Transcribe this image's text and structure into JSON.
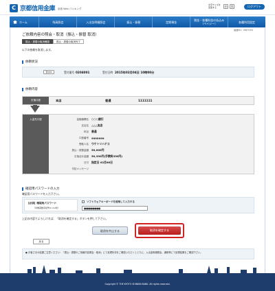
{
  "header": {
    "logo_mark": "C",
    "logo_text": "京都信用金庫",
    "logo_sub": "京信 Web バンキング",
    "font_size_label_1": "文字サイズを",
    "font_size_label_2": "変更する",
    "font_small": "小",
    "font_large": "大",
    "logout": "ログアウト"
  },
  "nav": {
    "items": [
      "ホーム",
      "残高照会",
      "入出金明細照会",
      "振込・振替",
      "定期預金",
      "税金・各種料金の払込み（ペイジー）",
      "各種利用設定"
    ]
  },
  "screen_id": "画面ID：BNT050",
  "main": {
    "title": "ご依頼内容の照会・取消（振込・振替 取消）",
    "steps": [
      "振込・振替の取消確認",
      "振込・振替の取消完了"
    ],
    "instruction": "以下の依頼を取消します。"
  },
  "request_status": {
    "heading": "依頼状況",
    "badge": "受付中",
    "receipt_no_label": "受付番号",
    "receipt_no": "0204001",
    "receipt_dt_label": "受付日時",
    "receipt_dt": "2015年02月04日 10時00分"
  },
  "request_content": {
    "heading": "依頼内容",
    "from_label": "引落口座",
    "from_branch": "本店",
    "from_type": "普通",
    "from_account": "1111111",
    "to_label": "入金先口座",
    "rows": [
      {
        "label": "金融機関名",
        "value": "○○○銀行"
      },
      {
        "label": "支店名",
        "value": "△△△支店"
      },
      {
        "label": "科目",
        "value": "普通"
      },
      {
        "label": "口座番号",
        "value": "9999999"
      },
      {
        "label": "受取人名",
        "value": "ウケトリハナコ"
      },
      {
        "label": "振込・振替金額",
        "value": "50,000円"
      },
      {
        "label": "引落合計金額",
        "value": "50,330円(手数料330円)"
      },
      {
        "label": "日付",
        "value": "指定日 02月06日"
      },
      {
        "label": "付記メッセージ",
        "value": ""
      }
    ]
  },
  "password": {
    "heading": "確認用パスワードの入力",
    "desc": "確認用パスワードを入力下さい。",
    "field_label": "【必須】確認用パスワード",
    "field_sub": "（半角英数字記号4〜12桁）",
    "software_kb_label": "ソフトウェアキーボードを使用して入力する",
    "value": "●●●●●●●●"
  },
  "confirm_text": "上記の内容でよろしければ、「取消を確定する」ボタンを押して下さい。",
  "buttons": {
    "cancel": "取消を中止する",
    "confirm": "取消を確定する",
    "back": "戻る"
  },
  "note": "● お客さまの結果ご注意ください：「振込・振替のご依頼内容照会・取消」にて処理状況をご確認いただくとともに、入出金明細照会、通帳等にて処理結果をご確認下さい。",
  "footer": {
    "copyright": "Copyright © THE KYOTO SHINKIN BANK. All rights reserved."
  },
  "colors": {
    "brand_blue": "#1565b0",
    "confirm_red": "#c62a2a"
  }
}
